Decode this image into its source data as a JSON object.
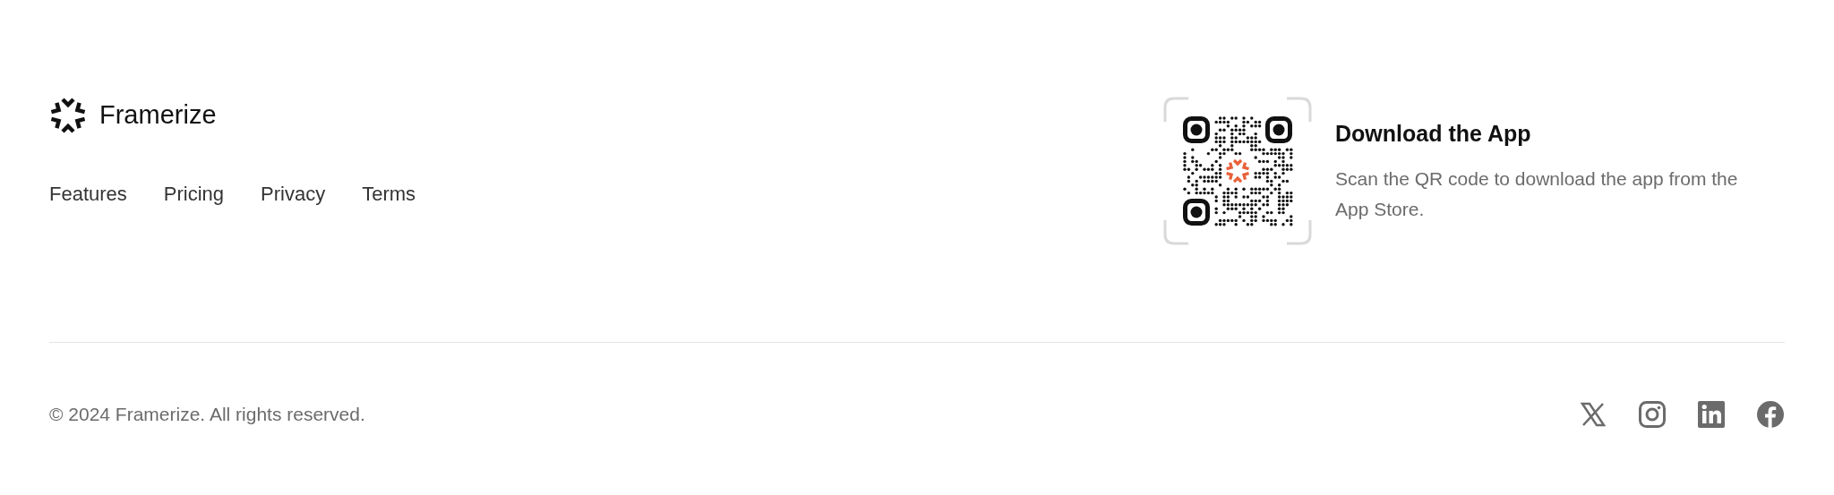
{
  "brand": {
    "name": "Framerize"
  },
  "nav_links": [
    "Features",
    "Pricing",
    "Privacy",
    "Terms"
  ],
  "app_download": {
    "title": "Download the App",
    "description": "Scan the QR code to download the app from the App Store."
  },
  "copyright": "© 2024 Framerize. All rights reserved.",
  "social_links": [
    {
      "kind": "x"
    },
    {
      "kind": "instagram"
    },
    {
      "kind": "linkedin"
    },
    {
      "kind": "facebook"
    }
  ]
}
